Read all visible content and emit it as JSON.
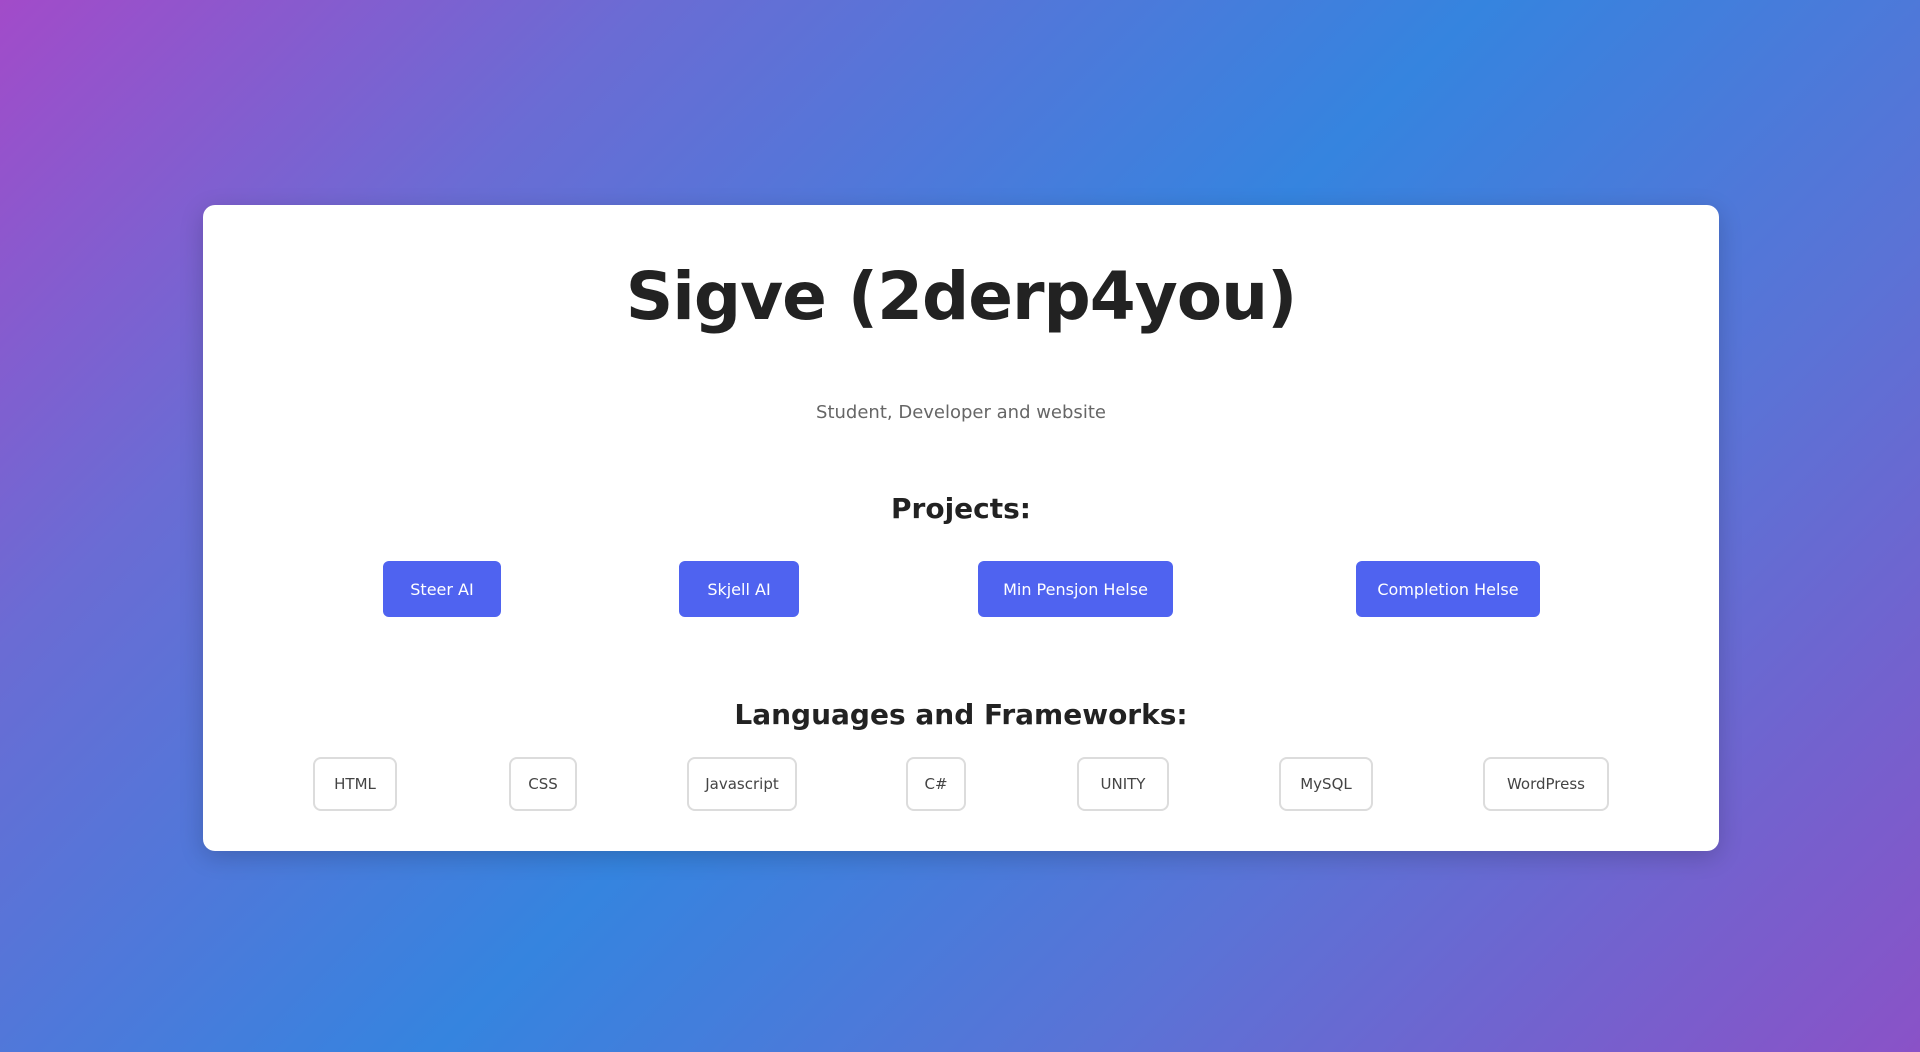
{
  "profile": {
    "title": "Sigve (2derp4you)",
    "subtitle": "Student, Developer and website"
  },
  "projects": {
    "heading": "Projects:",
    "buttons": [
      {
        "label": "Steer AI"
      },
      {
        "label": "Skjell AI"
      },
      {
        "label": "Min Pensjon Helse"
      },
      {
        "label": "Completion Helse"
      }
    ]
  },
  "languages": {
    "heading": "Languages and Frameworks:",
    "tags": [
      {
        "label": "HTML"
      },
      {
        "label": "CSS"
      },
      {
        "label": "Javascript"
      },
      {
        "label": "C#"
      },
      {
        "label": "UNITY"
      },
      {
        "label": "MySQL"
      },
      {
        "label": "WordPress"
      }
    ]
  },
  "colors": {
    "accent": "#4f63f0",
    "card_bg": "#ffffff",
    "gradient_start": "#a24bc9",
    "gradient_mid": "#3584df",
    "gradient_end": "#8a52c7"
  }
}
